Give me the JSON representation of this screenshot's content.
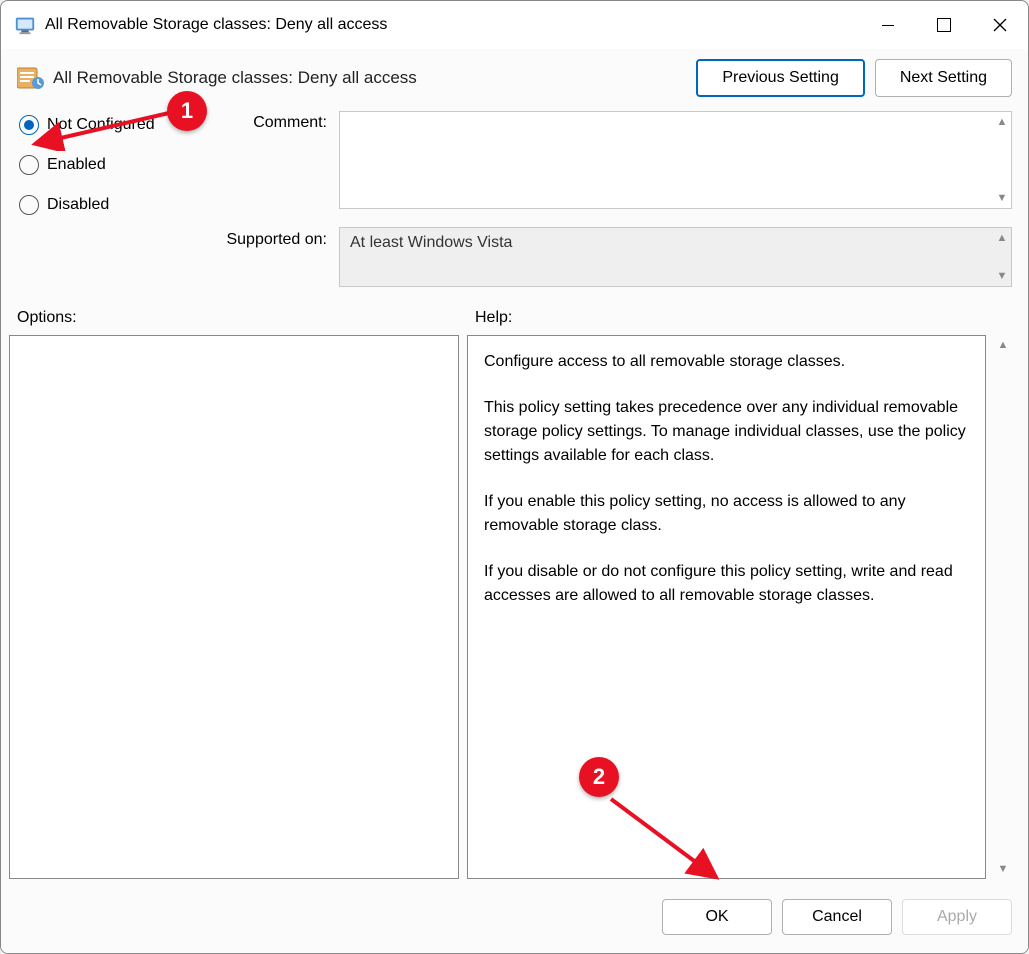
{
  "window": {
    "title": "All Removable Storage classes: Deny all access"
  },
  "header": {
    "setting_name": "All Removable Storage classes: Deny all access",
    "previous_label": "Previous Setting",
    "next_label": "Next Setting"
  },
  "radios": {
    "not_configured": "Not Configured",
    "enabled": "Enabled",
    "disabled": "Disabled",
    "selected": "not_configured"
  },
  "labels": {
    "comment": "Comment:",
    "supported_on": "Supported on:",
    "options": "Options:",
    "help": "Help:"
  },
  "comment_text": "",
  "supported_text": "At least Windows Vista",
  "help_text": {
    "p1": "Configure access to all removable storage classes.",
    "p2": "This policy setting takes precedence over any individual removable storage policy settings. To manage individual classes, use the policy settings available for each class.",
    "p3": "If you enable this policy setting, no access is allowed to any removable storage class.",
    "p4": "If you disable or do not configure this policy setting, write and read accesses are allowed to all removable storage classes."
  },
  "buttons": {
    "ok": "OK",
    "cancel": "Cancel",
    "apply": "Apply"
  },
  "annotations": {
    "badge1": "1",
    "badge2": "2"
  }
}
